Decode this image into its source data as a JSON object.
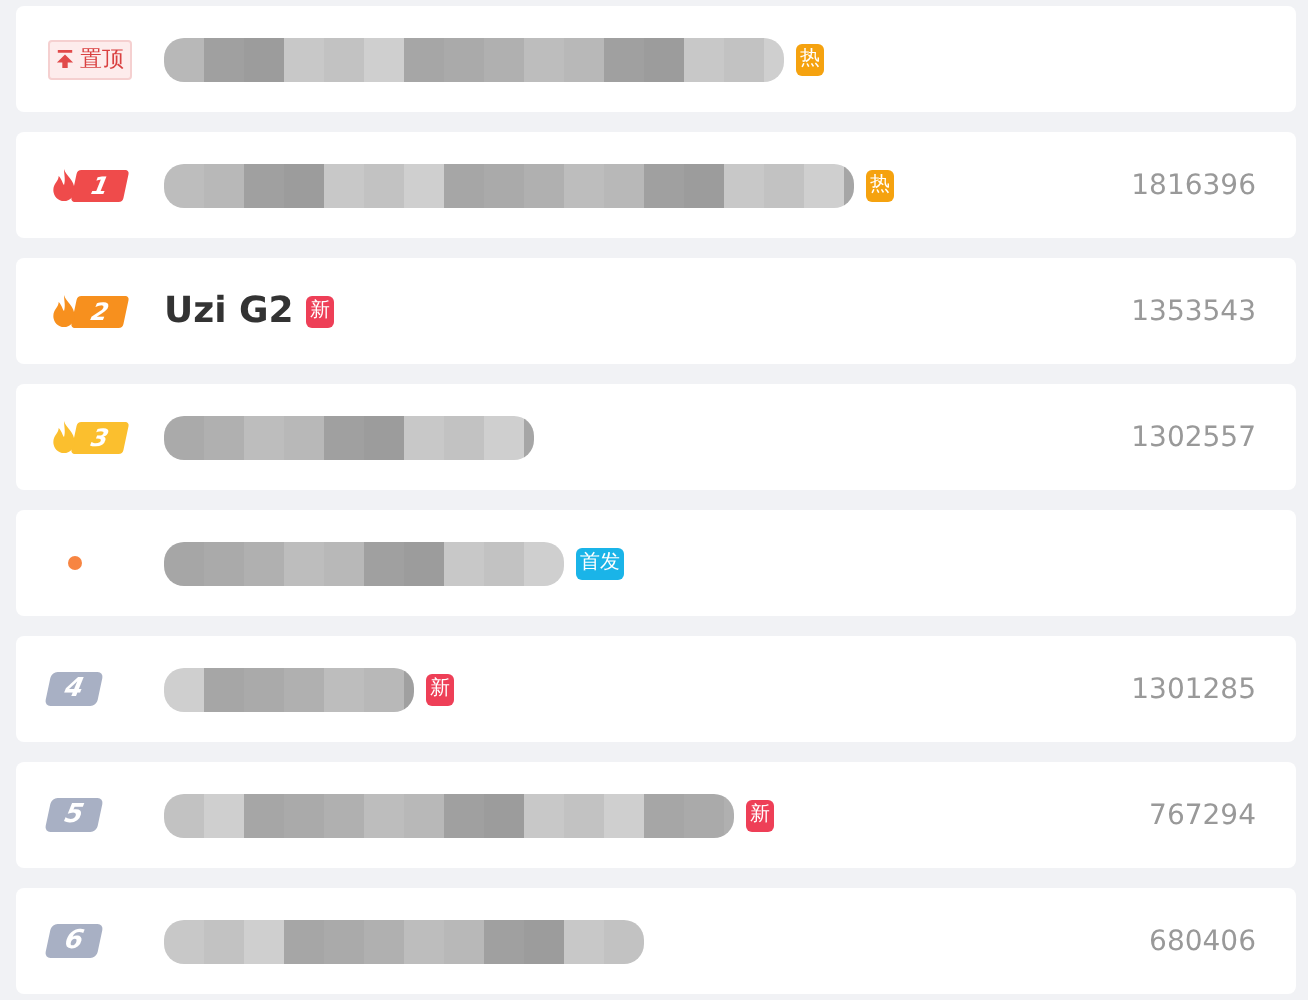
{
  "hot_list": [
    {
      "kind": "pinned",
      "rank": "置顶",
      "tag": {
        "text": "热",
        "color": "#f5a20f"
      }
    },
    {
      "kind": "top",
      "rank": "1",
      "color": "#ef4b4b",
      "tag": {
        "text": "热",
        "color": "#f5a20f"
      },
      "count": "1816396"
    },
    {
      "kind": "top",
      "rank": "2",
      "color": "#f7901e",
      "title": {
        "kind": "text",
        "text": "Uzi G2"
      },
      "tag": {
        "text": "新",
        "color": "#ee3f57"
      },
      "count": "1353543"
    },
    {
      "kind": "top",
      "rank": "3",
      "color": "#fbbf2e",
      "count": "1302557"
    },
    {
      "kind": "dot",
      "tag": {
        "text": "首发",
        "color": "#1ab4e8"
      }
    },
    {
      "kind": "plain",
      "rank": "4",
      "tag": {
        "text": "新",
        "color": "#ee3f57"
      },
      "count": "1301285"
    },
    {
      "kind": "plain",
      "rank": "5",
      "tag": {
        "text": "新",
        "color": "#ee3f57"
      },
      "count": "767294"
    },
    {
      "kind": "plain",
      "rank": "6",
      "count": "680406"
    }
  ]
}
